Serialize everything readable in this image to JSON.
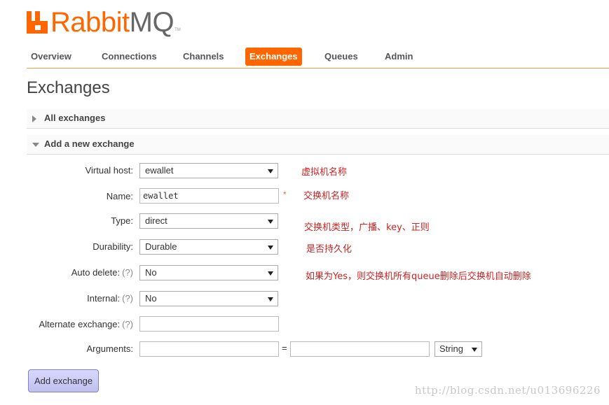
{
  "logo": {
    "rabbit": "Rabbit",
    "mq": "MQ",
    "tm": "TM"
  },
  "nav": {
    "items": [
      {
        "label": "Overview",
        "active": false
      },
      {
        "label": "Connections",
        "active": false
      },
      {
        "label": "Channels",
        "active": false
      },
      {
        "label": "Exchanges",
        "active": true
      },
      {
        "label": "Queues",
        "active": false
      },
      {
        "label": "Admin",
        "active": false
      }
    ]
  },
  "page": {
    "title": "Exchanges"
  },
  "sections": {
    "all": "All exchanges",
    "add": "Add a new exchange"
  },
  "form": {
    "help": "(?)",
    "virtual_host": {
      "label": "Virtual host:",
      "value": "ewallet",
      "note": "虚拟机名称"
    },
    "name": {
      "label": "Name:",
      "value": "ewallet",
      "required": "*",
      "note": "交换机名称"
    },
    "type": {
      "label": "Type:",
      "value": "direct",
      "note": "交换机类型，广播、key、正则"
    },
    "durability": {
      "label": "Durability:",
      "value": "Durable",
      "note": "是否持久化"
    },
    "auto_delete": {
      "label": "Auto delete:",
      "value": "No",
      "note": "如果为Yes，则交换机所有queue删除后交换机自动删除"
    },
    "internal": {
      "label": "Internal:",
      "value": "No"
    },
    "alternate": {
      "label": "Alternate exchange:",
      "value": ""
    },
    "arguments": {
      "label": "Arguments:",
      "equals": "=",
      "type_value": "String"
    },
    "submit": "Add exchange"
  },
  "watermark": "http://blog.csdn.net/u013696226"
}
